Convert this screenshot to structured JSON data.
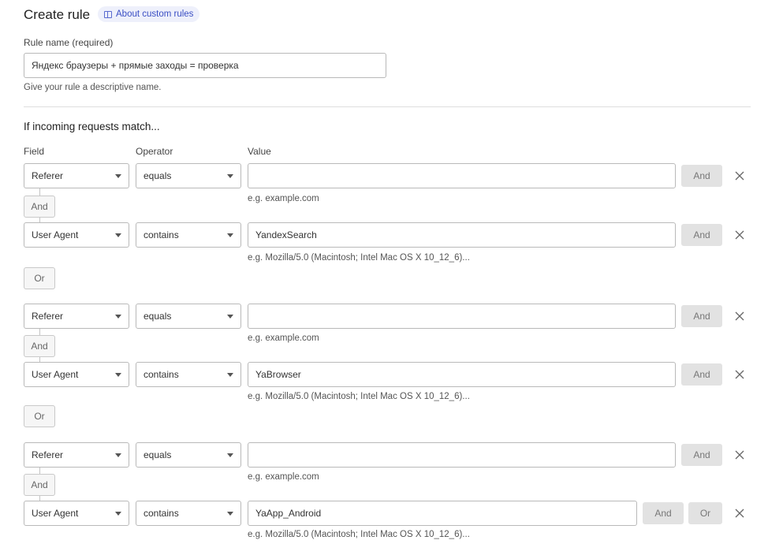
{
  "header": {
    "title": "Create rule",
    "about_link": "About custom rules"
  },
  "rule_name": {
    "label": "Rule name (required)",
    "value": "Яндекс браузеры + прямые заходы = проверка",
    "help": "Give your rule a descriptive name."
  },
  "section_title": "If incoming requests match...",
  "columns": {
    "field": "Field",
    "operator": "Operator",
    "value": "Value"
  },
  "buttons": {
    "and": "And",
    "or": "Or"
  },
  "groups": [
    {
      "conditions": [
        {
          "field": "Referer",
          "operator": "equals",
          "value": "",
          "hint": "e.g. example.com"
        },
        {
          "field": "User Agent",
          "operator": "contains",
          "value": "YandexSearch",
          "hint": "e.g. Mozilla/5.0 (Macintosh; Intel Mac OS X 10_12_6)..."
        }
      ]
    },
    {
      "conditions": [
        {
          "field": "Referer",
          "operator": "equals",
          "value": "",
          "hint": "e.g. example.com"
        },
        {
          "field": "User Agent",
          "operator": "contains",
          "value": "YaBrowser",
          "hint": "e.g. Mozilla/5.0 (Macintosh; Intel Mac OS X 10_12_6)..."
        }
      ]
    },
    {
      "conditions": [
        {
          "field": "Referer",
          "operator": "equals",
          "value": "",
          "hint": "e.g. example.com"
        },
        {
          "field": "User Agent",
          "operator": "contains",
          "value": "YaApp_Android",
          "hint": "e.g. Mozilla/5.0 (Macintosh; Intel Mac OS X 10_12_6)..."
        }
      ]
    }
  ]
}
